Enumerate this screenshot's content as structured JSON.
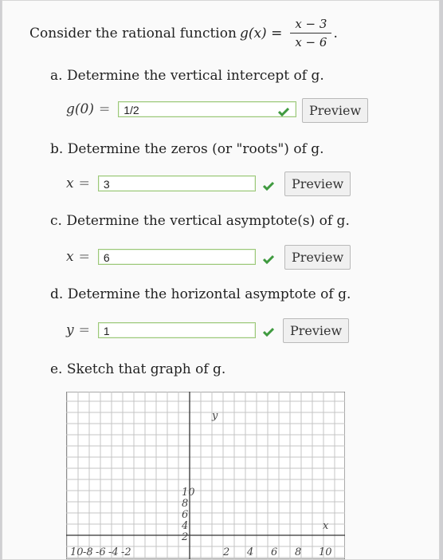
{
  "intro": {
    "text": "Consider the rational function",
    "func_lhs": "g(x) =",
    "numerator": "x − 3",
    "denominator": "x − 6",
    "period": "."
  },
  "part_a": {
    "question": "a. Determine the vertical intercept of g.",
    "lhs": "g(0)",
    "eq": "=",
    "answer": "1/2",
    "preview_label": "Preview"
  },
  "part_b": {
    "question": "b. Determine the zeros (or \"roots\") of g.",
    "lhs": "x",
    "eq": "=",
    "answer": "3",
    "preview_label": "Preview"
  },
  "part_c": {
    "question": "c. Determine the vertical asymptote(s) of g.",
    "lhs": "x",
    "eq": "=",
    "answer": "6",
    "preview_label": "Preview"
  },
  "part_d": {
    "question": "d. Determine the horizontal asymptote of g.",
    "lhs": "y",
    "eq": "=",
    "answer": "1",
    "preview_label": "Preview"
  },
  "part_e": {
    "question": "e. Sketch that graph of g."
  },
  "graph": {
    "y_axis_label": "y",
    "x_axis_label": "x",
    "y_tick_labels": [
      "10",
      "8",
      "6",
      "4",
      "2"
    ],
    "x_tick_labels_negative": [
      "10",
      "-8",
      "-6",
      "-4",
      "-2"
    ],
    "x_tick_labels_positive": [
      "2",
      "4",
      "6",
      "8",
      "10"
    ]
  },
  "colors": {
    "check_green": "#3f9a3f",
    "field_border": "#9cc879",
    "grid_line": "#bdbdbd"
  }
}
